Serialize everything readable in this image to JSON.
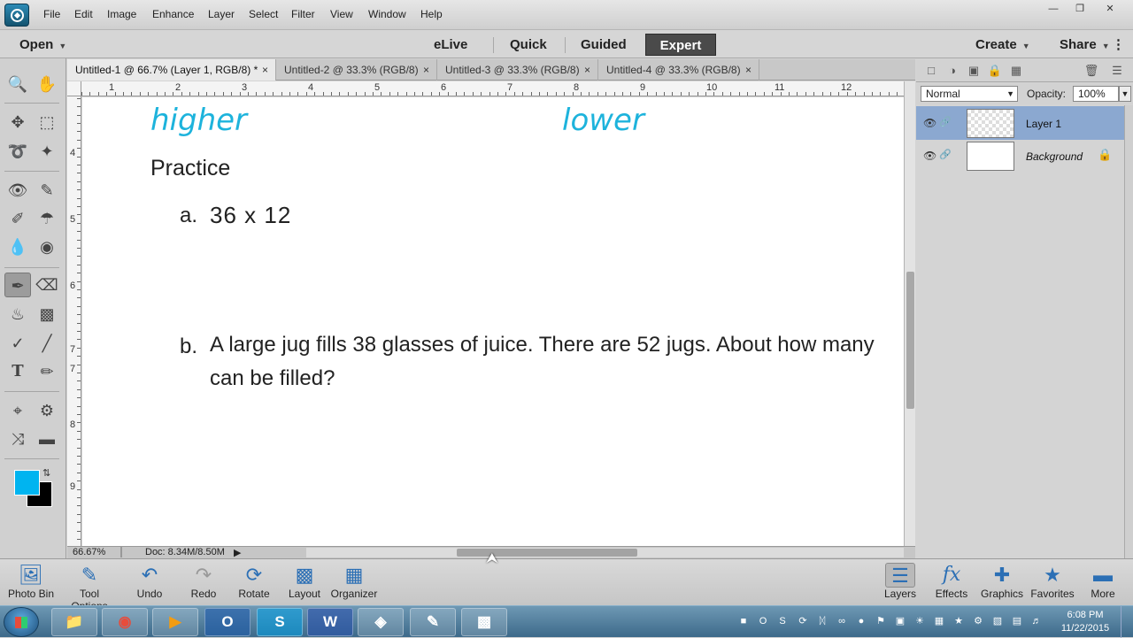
{
  "menubar": {
    "items": [
      "File",
      "Edit",
      "Image",
      "Enhance",
      "Layer",
      "Select",
      "Filter",
      "View",
      "Window",
      "Help"
    ]
  },
  "modebar": {
    "open_label": "Open",
    "modes": [
      "eLive",
      "Quick",
      "Guided",
      "Expert"
    ],
    "active_mode": "Expert",
    "create_label": "Create",
    "share_label": "Share"
  },
  "doc_tabs": [
    {
      "label": "Untitled-1 @ 66.7% (Layer 1, RGB/8) *",
      "active": true
    },
    {
      "label": "Untitled-2 @ 33.3% (RGB/8)",
      "active": false
    },
    {
      "label": "Untitled-3 @ 33.3% (RGB/8)",
      "active": false
    },
    {
      "label": "Untitled-4 @ 33.3% (RGB/8)",
      "active": false
    }
  ],
  "rulers": {
    "top": [
      "1",
      "2",
      "3",
      "4",
      "5",
      "6",
      "7",
      "8",
      "9",
      "10",
      "11",
      "12"
    ],
    "left": [
      "4",
      "5",
      "6",
      "7",
      "7",
      "8",
      "9"
    ]
  },
  "canvas": {
    "ink_words": [
      "higher",
      "lower"
    ],
    "practice_title": "Practice",
    "question_a_label": "a.",
    "question_a_text": "36 x 12",
    "question_b_label": "b.",
    "question_b_line1": "A large jug fills 38 glasses of juice. There are 52 jugs. About how many",
    "question_b_line2": "can be filled?"
  },
  "status": {
    "zoom": "66.67%",
    "doc_size": "Doc: 8.34M/8.50M"
  },
  "layers_panel": {
    "blend_mode": "Normal",
    "opacity_label": "Opacity:",
    "opacity_value": "100%",
    "layers": [
      {
        "name": "Layer 1",
        "selected": true
      },
      {
        "name": "Background",
        "selected": false
      }
    ]
  },
  "bottombar": {
    "left_buttons": [
      "Photo Bin",
      "Tool Options",
      "Undo",
      "Redo",
      "Rotate",
      "Layout",
      "Organizer"
    ],
    "right_buttons": [
      "Layers",
      "Effects",
      "Graphics",
      "Favorites",
      "More"
    ]
  },
  "colors": {
    "foreground": "#00b4f0",
    "background": "#000000",
    "ink": "#1db3dc",
    "layer_selected": "#8ba8d0"
  },
  "taskbar": {
    "apps": [
      "explorer-icon",
      "chrome-icon",
      "media-icon",
      "outlook-icon",
      "skype-icon",
      "word-icon",
      "elements-icon",
      "notes-icon",
      "app-icon"
    ],
    "clock_time": "6:08 PM",
    "clock_date": "11/22/2015"
  }
}
